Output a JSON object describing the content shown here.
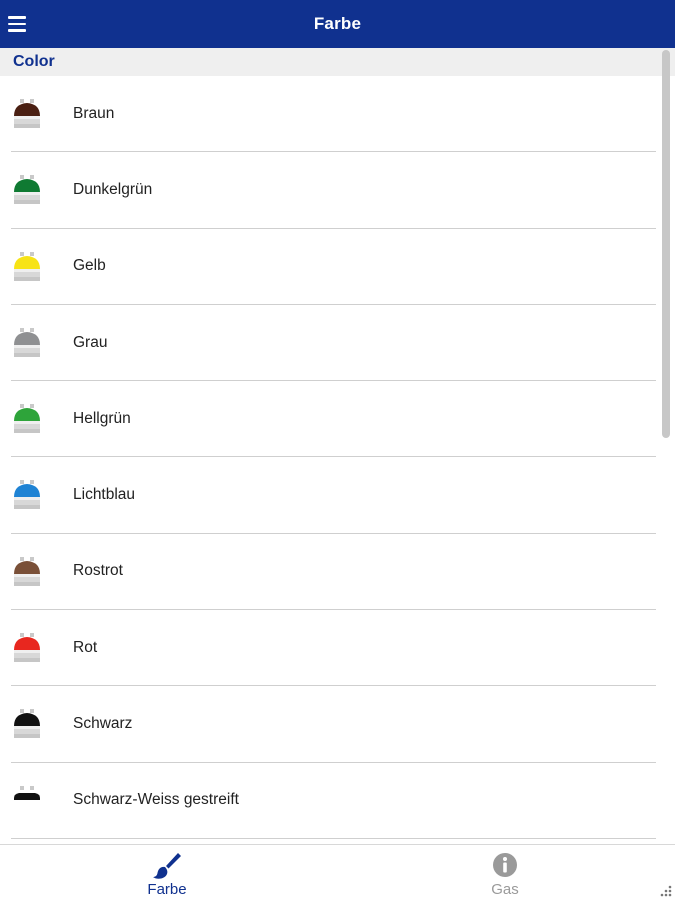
{
  "header": {
    "title": "Farbe",
    "menu_icon": "hamburger-menu-icon",
    "background": "#10318f"
  },
  "section": {
    "title": "Color"
  },
  "items": [
    {
      "label": "Braun",
      "color": "#4a1f12",
      "icon": "gas-cylinder-icon"
    },
    {
      "label": "Dunkelgrün",
      "color": "#0f7a32",
      "icon": "gas-cylinder-icon"
    },
    {
      "label": "Gelb",
      "color": "#f7e316",
      "icon": "gas-cylinder-icon"
    },
    {
      "label": "Grau",
      "color": "#8f9092",
      "icon": "gas-cylinder-icon"
    },
    {
      "label": "Hellgrün",
      "color": "#2ea43a",
      "icon": "gas-cylinder-icon"
    },
    {
      "label": "Lichtblau",
      "color": "#1f83d4",
      "icon": "gas-cylinder-icon"
    },
    {
      "label": "Rostrot",
      "color": "#7a5038",
      "icon": "gas-cylinder-icon"
    },
    {
      "label": "Rot",
      "color": "#e8271f",
      "icon": "gas-cylinder-icon"
    },
    {
      "label": "Schwarz",
      "color": "#111111",
      "icon": "gas-cylinder-icon"
    },
    {
      "label": "Schwarz-Weiss gestreift",
      "color": "#111111",
      "icon": "gas-cylinder-striped-icon"
    }
  ],
  "bottom_nav": {
    "tabs": [
      {
        "label": "Farbe",
        "icon": "paintbrush-icon",
        "active": true,
        "color": "#10318f"
      },
      {
        "label": "Gas",
        "icon": "info-icon",
        "active": false,
        "color": "#9a9a9a"
      }
    ]
  }
}
